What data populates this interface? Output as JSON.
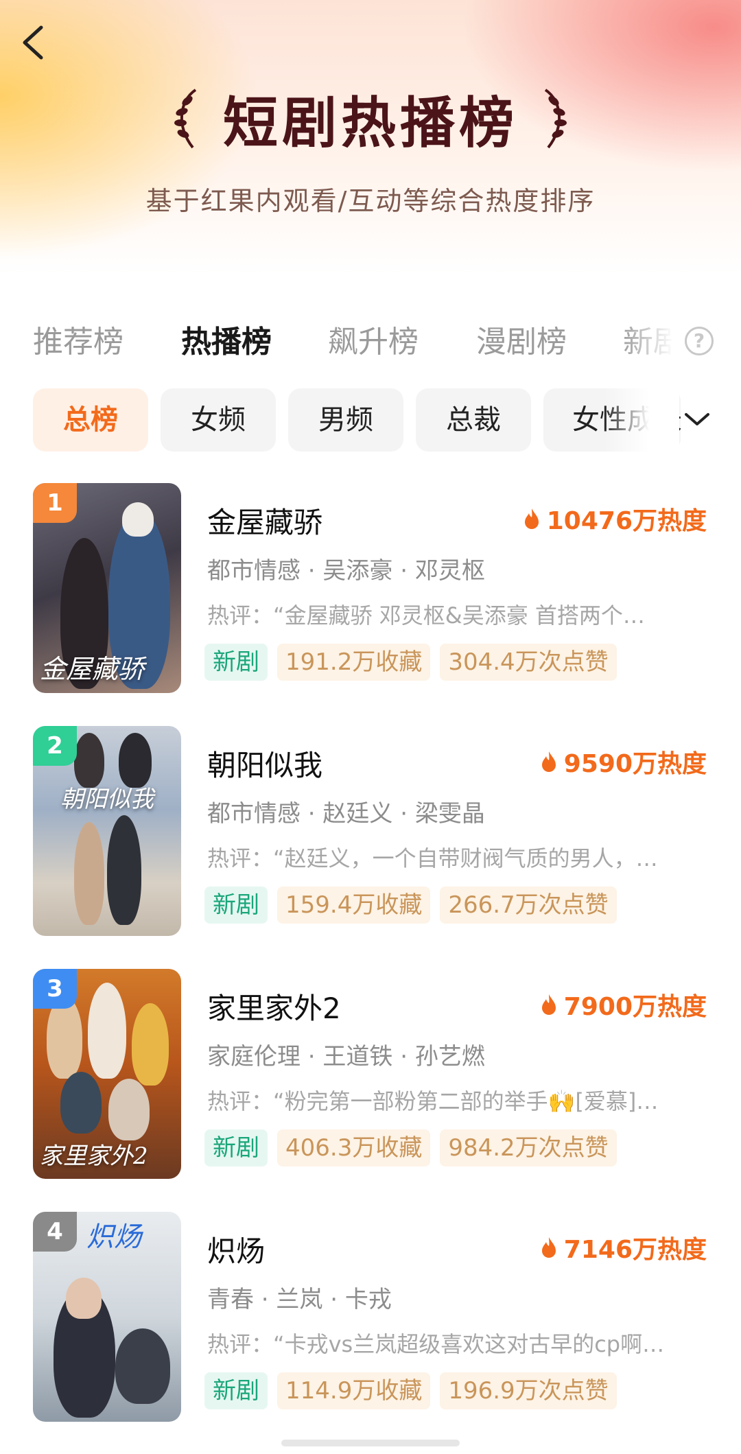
{
  "header": {
    "title": "短剧热播榜",
    "subtitle": "基于红果内观看/互动等综合热度排序"
  },
  "tabs": [
    {
      "label": "推荐榜",
      "active": false
    },
    {
      "label": "热播榜",
      "active": true
    },
    {
      "label": "飙升榜",
      "active": false
    },
    {
      "label": "漫剧榜",
      "active": false
    },
    {
      "label": "新剧",
      "active": false
    }
  ],
  "help_icon": "?",
  "chips": [
    {
      "label": "总榜",
      "active": true
    },
    {
      "label": "女频",
      "active": false
    },
    {
      "label": "男频",
      "active": false
    },
    {
      "label": "总裁",
      "active": false
    },
    {
      "label": "女性成长",
      "active": false
    }
  ],
  "colors": {
    "accent": "#f26a1b",
    "title_dark": "#4b1418",
    "tag_new": "#1aa67a",
    "tag_stat": "#c9955a",
    "rank_1": "#f5883a",
    "rank_2": "#2fcf96",
    "rank_3": "#3f8df2",
    "rank_4": "#8a8a8a"
  },
  "items": [
    {
      "rank": "1",
      "title": "金屋藏骄",
      "heat": "10476万热度",
      "meta": "都市情感 · 吴添豪 · 邓灵枢",
      "review": "热评：“金屋藏骄 邓灵枢&吴添豪 首搭两个…",
      "tag_new": "新剧",
      "favorites": "191.2万收藏",
      "likes": "304.4万次点赞",
      "poster_caption": "金屋藏骄"
    },
    {
      "rank": "2",
      "title": "朝阳似我",
      "heat": "9590万热度",
      "meta": "都市情感 · 赵廷义 · 梁雯晶",
      "review": "热评：“赵廷义，一个自带财阀气质的男人，…",
      "tag_new": "新剧",
      "favorites": "159.4万收藏",
      "likes": "266.7万次点赞",
      "poster_caption": "朝阳似我"
    },
    {
      "rank": "3",
      "title": "家里家外2",
      "heat": "7900万热度",
      "meta": "家庭伦理 · 王道铁 · 孙艺燃",
      "review": "热评：“粉完第一部粉第二部的举手🙌[爱慕]…",
      "tag_new": "新剧",
      "favorites": "406.3万收藏",
      "likes": "984.2万次点赞",
      "poster_caption": "家里家外2"
    },
    {
      "rank": "4",
      "title": "炽炀",
      "heat": "7146万热度",
      "meta": "青春 · 兰岚 · 卡戎",
      "review": "热评：“卡戎vs兰岚超级喜欢这对古早的cp啊…",
      "tag_new": "新剧",
      "favorites": "114.9万收藏",
      "likes": "196.9万次点赞",
      "poster_caption": "炽炀"
    }
  ]
}
